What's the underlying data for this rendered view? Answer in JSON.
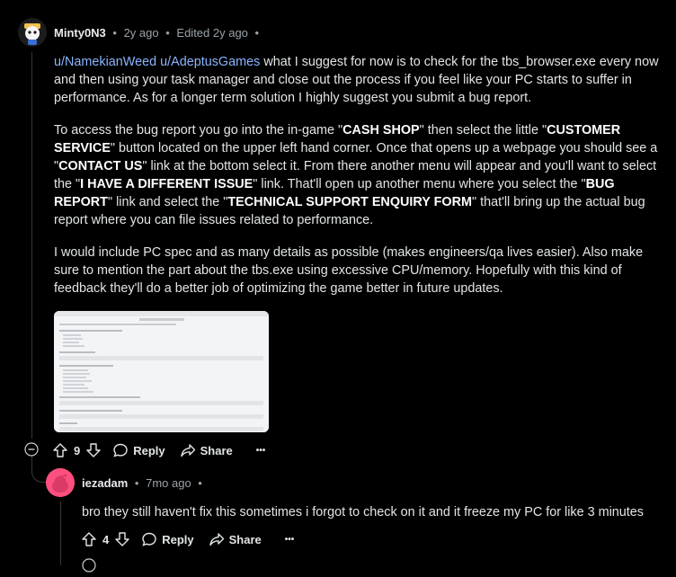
{
  "comment1": {
    "username": "Minty0N3",
    "time": "2y ago",
    "edited": "Edited 2y ago",
    "paragraph1": {
      "mention1": "u/NamekianWeed",
      "mention2": "u/AdeptusGames",
      "text": "what I suggest for now is to check for the tbs_browser.exe every now and then using your task manager and close out the process if you feel like your PC starts to suffer in performance. As for a longer term solution I highly suggest you submit a bug report."
    },
    "paragraph2": {
      "p1": "To access the bug report you go into the in-game \"",
      "b1": "CASH SHOP",
      "p2": "\" then select the little \"",
      "b2": "CUSTOMER SERVICE",
      "p3": "\" button located on the upper left hand corner. Once that opens up a webpage you should see a \"",
      "b3": "CONTACT US",
      "p4": "\" link at the bottom select it. From there another menu will appear and you'll want to select the \"",
      "b4": "I HAVE A DIFFERENT ISSUE",
      "p5": "\" link. That'll open up another menu where you select the \"",
      "b5": "BUG REPORT",
      "p6": "\" link and select the \"",
      "b6": "TECHNICAL SUPPORT ENQUIRY FORM",
      "p7": "\" that'll bring up the actual bug report where you can file issues related to performance."
    },
    "paragraph3": "I would include PC spec and as many details as possible (makes engineers/qa lives easier). Also make sure to mention the part about the tbs.exe using excessive CPU/memory. Hopefully with this kind of feedback they'll do a better job of optimizing the game better in future updates.",
    "votes": "9",
    "reply_label": "Reply",
    "share_label": "Share",
    "more_label": "•••"
  },
  "comment2": {
    "username": "iezadam",
    "time": "7mo ago",
    "text": "bro they still haven't fix this sometimes i forgot to check on it and it freeze my PC for like 3 minutes",
    "votes": "4",
    "reply_label": "Reply",
    "share_label": "Share",
    "more_label": "•••"
  },
  "colors": {
    "background": "#000000",
    "link": "#8ab4ff",
    "text": "#e2e5e7",
    "avatar2_bg": "#ff4f7e"
  }
}
